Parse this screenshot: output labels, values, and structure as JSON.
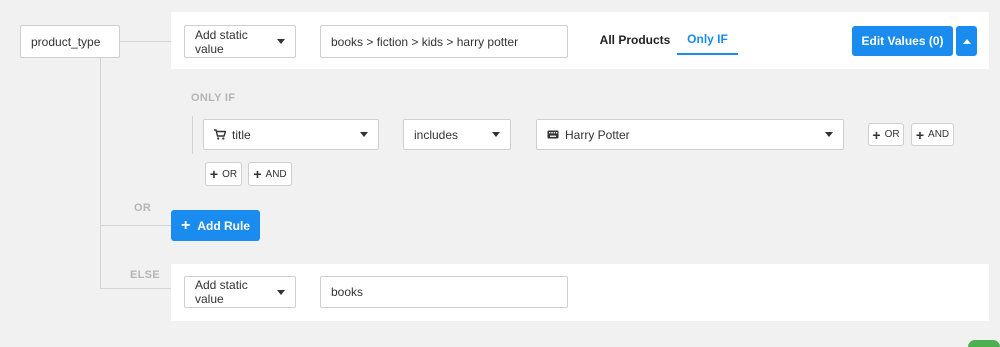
{
  "root_field": {
    "label": "product_type"
  },
  "if_row": {
    "source_select": "Add static value",
    "value": "books > fiction > kids > harry potter",
    "tabs": [
      {
        "label": "All Products",
        "active": false
      },
      {
        "label": "Only IF",
        "active": true
      }
    ],
    "edit_values_label": "Edit Values (0)"
  },
  "only_if": {
    "section_label": "ONLY IF",
    "condition": {
      "attribute": "title",
      "attribute_icon": "cart-icon",
      "operator": "includes",
      "value": "Harry Potter",
      "value_icon": "keyboard-icon"
    },
    "row_or_label": "OR",
    "row_and_label": "AND",
    "group_or_label": "OR",
    "group_and_label": "AND"
  },
  "or_section": {
    "label": "OR",
    "add_rule_label": "Add Rule"
  },
  "else_section": {
    "label": "ELSE",
    "source_select": "Add static value",
    "value": "books"
  },
  "colors": {
    "accent": "#1a8cf0",
    "background": "#f1f1f1",
    "panel": "#ffffff",
    "border": "#cfcfcf"
  }
}
